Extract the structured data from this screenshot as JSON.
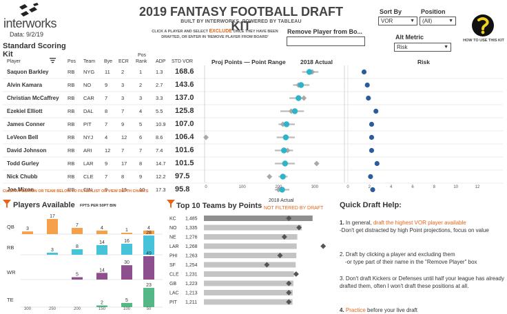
{
  "brand": {
    "name": "interworks",
    "date": "Data: 9/2/19"
  },
  "header": {
    "title": "2019 FANTASY FOOTBALL DRAFT KIT",
    "subtitle": "BUILT BY INTERWORKS, POWERED BY TABLEAU",
    "instruction_pre": "CLICK A PLAYER AND SELECT",
    "instruction_exclude": "EXCLUDE",
    "instruction_post": "ONCE THEY HAVE BEEN DRAFTED, OR ENTER IN 'REMOVE PLAYER FROM BOARD'",
    "remove_label": "Remove Player from Bo...",
    "remove_value": ""
  },
  "controls": {
    "sort_by_label": "Sort By",
    "sort_by_value": "VOR",
    "position_label": "Position",
    "position_value": "(All)",
    "alt_metric_label": "Alt Metric",
    "alt_metric_value": "Risk",
    "help_label": "HOW TO USE THIS KIT"
  },
  "scoring": {
    "line1": "Standard Scoring",
    "line2": "Kit"
  },
  "table": {
    "headers": {
      "player": "Player",
      "pos": "Pos",
      "team": "Team",
      "bye": "Bye",
      "ecr": "ECR",
      "pos_rank_1": "Pos",
      "pos_rank_2": "Rank",
      "adp": "ADP",
      "vor": "STD VOR"
    },
    "proj_header": "Proj Points  — Point Range",
    "actual_header": "2018 Actual",
    "risk_header": "Risk",
    "proj_axis": [
      "0",
      "100",
      "200",
      "300"
    ],
    "risk_axis": [
      "0",
      "2",
      "4",
      "6",
      "8",
      "10",
      "12"
    ],
    "rows": [
      {
        "player": "Saquon Barkley",
        "pos": "RB",
        "team": "NYG",
        "bye": "11",
        "ecr": "2",
        "rank": "1",
        "adp": "1.3",
        "vor": "168.6"
      },
      {
        "player": "Alvin Kamara",
        "pos": "RB",
        "team": "NO",
        "bye": "9",
        "ecr": "3",
        "rank": "2",
        "adp": "2.7",
        "vor": "143.6"
      },
      {
        "player": "Christian McCaffrey",
        "pos": "RB",
        "team": "CAR",
        "bye": "7",
        "ecr": "3",
        "rank": "3",
        "adp": "3.3",
        "vor": "137.0"
      },
      {
        "player": "Ezekiel Elliott",
        "pos": "RB",
        "team": "DAL",
        "bye": "8",
        "ecr": "7",
        "rank": "4",
        "adp": "5.5",
        "vor": "125.8"
      },
      {
        "player": "James Conner",
        "pos": "RB",
        "team": "PIT",
        "bye": "7",
        "ecr": "9",
        "rank": "5",
        "adp": "10.9",
        "vor": "107.0"
      },
      {
        "player": "LeVeon Bell",
        "pos": "RB",
        "team": "NYJ",
        "bye": "4",
        "ecr": "12",
        "rank": "6",
        "adp": "8.6",
        "vor": "106.4"
      },
      {
        "player": "David Johnson",
        "pos": "RB",
        "team": "ARI",
        "bye": "12",
        "ecr": "7",
        "rank": "7",
        "adp": "7.4",
        "vor": "101.6"
      },
      {
        "player": "Todd Gurley",
        "pos": "RB",
        "team": "LAR",
        "bye": "9",
        "ecr": "17",
        "rank": "8",
        "adp": "14.7",
        "vor": "101.5"
      },
      {
        "player": "Nick Chubb",
        "pos": "RB",
        "team": "CLE",
        "bye": "7",
        "ecr": "8",
        "rank": "9",
        "adp": "12.2",
        "vor": "97.5"
      },
      {
        "player": "Joe Mixon",
        "pos": "RB",
        "team": "CIN",
        "bye": "9",
        "ecr": "15",
        "rank": "10",
        "adp": "17.3",
        "vor": "95.8"
      }
    ],
    "proj": [
      {
        "proj": 285,
        "lo": 265,
        "hi": 310,
        "actual": 293
      },
      {
        "proj": 262,
        "lo": 240,
        "hi": 285,
        "actual": 255
      },
      {
        "proj": 255,
        "lo": 230,
        "hi": 275,
        "actual": 270
      },
      {
        "proj": 245,
        "lo": 205,
        "hi": 270,
        "actual": 235
      },
      {
        "proj": 222,
        "lo": 200,
        "hi": 245,
        "actual": 212
      },
      {
        "proj": 220,
        "lo": 195,
        "hi": 245,
        "actual": 0
      },
      {
        "proj": 215,
        "lo": 190,
        "hi": 240,
        "actual": 225
      },
      {
        "proj": 218,
        "lo": 190,
        "hi": 245,
        "actual": 305
      },
      {
        "proj": 212,
        "lo": 200,
        "hi": 225,
        "actual": 175
      },
      {
        "proj": 210,
        "lo": 190,
        "hi": 230,
        "actual": 200
      }
    ],
    "risk": [
      1.5,
      1.8,
      1.9,
      2.6,
      2.2,
      2.2,
      2.2,
      2.7,
      2.1,
      2.3
    ]
  },
  "filter_note": "CLICK A POSITION OR TEAM BELOW TO FILTER LIST OR VIEW DEPTH CHARTS",
  "players_available": {
    "title": "Players Available",
    "subtitle": "FPTS PER 50PT BIN",
    "bins": [
      "300",
      "250",
      "200",
      "150",
      "100",
      "50"
    ],
    "rows": [
      {
        "pos": "QB",
        "color": "#f5a04a",
        "values": [
          3,
          17,
          7,
          4,
          1,
          4
        ]
      },
      {
        "pos": "RB",
        "color": "#47c3d9",
        "values": [
          null,
          3,
          8,
          14,
          16,
          28
        ]
      },
      {
        "pos": "WR",
        "color": "#8e4f8f",
        "values": [
          null,
          null,
          5,
          14,
          30,
          49
        ]
      },
      {
        "pos": "TE",
        "color": "#53b885",
        "values": [
          null,
          null,
          null,
          2,
          5,
          23
        ]
      }
    ]
  },
  "top_teams": {
    "title": "Top 10 Teams by Points",
    "actual_label": "2018 Actual",
    "not_filtered": "NOT FILTERED BY DRAFT",
    "max": 1600,
    "rows": [
      {
        "team": "KC",
        "points": 1485,
        "label": "1,485",
        "actual": 1160
      },
      {
        "team": "NO",
        "points": 1335,
        "label": "1,335",
        "actual": 1300
      },
      {
        "team": "NE",
        "points": 1276,
        "label": "1,276",
        "actual": 1100
      },
      {
        "team": "LAR",
        "points": 1268,
        "label": "1,268",
        "actual": 1630
      },
      {
        "team": "PHI",
        "points": 1263,
        "label": "1,263",
        "actual": 1040
      },
      {
        "team": "SF",
        "points": 1254,
        "label": "1,254",
        "actual": 860
      },
      {
        "team": "CLE",
        "points": 1231,
        "label": "1,231",
        "actual": 1260
      },
      {
        "team": "GB",
        "points": 1223,
        "label": "1,223",
        "actual": 1160
      },
      {
        "team": "LAC",
        "points": 1213,
        "label": "1,213",
        "actual": 1160
      },
      {
        "team": "PIT",
        "points": 1211,
        "label": "1,211",
        "actual": 1160
      }
    ]
  },
  "quick_help": {
    "title": "Quick Draft Help:",
    "p1_num": "1.",
    "p1_pre": "In general,",
    "p1_link": "draft the highest VOR player available",
    "p1_rest": "-Don't get distracted by high Point projections, focus on value",
    "p2": "2. Draft by clicking a player and excluding them",
    "p2_rest": "-or type part of their name in the \"Remove Player\" box",
    "p3": "3. Don't draft Kickers or Defenses until half your league has already drafted them, often I won't draft these positions at all.",
    "p4_num": "4.",
    "p4_link": "Practice",
    "p4_rest": "before your live draft"
  }
}
